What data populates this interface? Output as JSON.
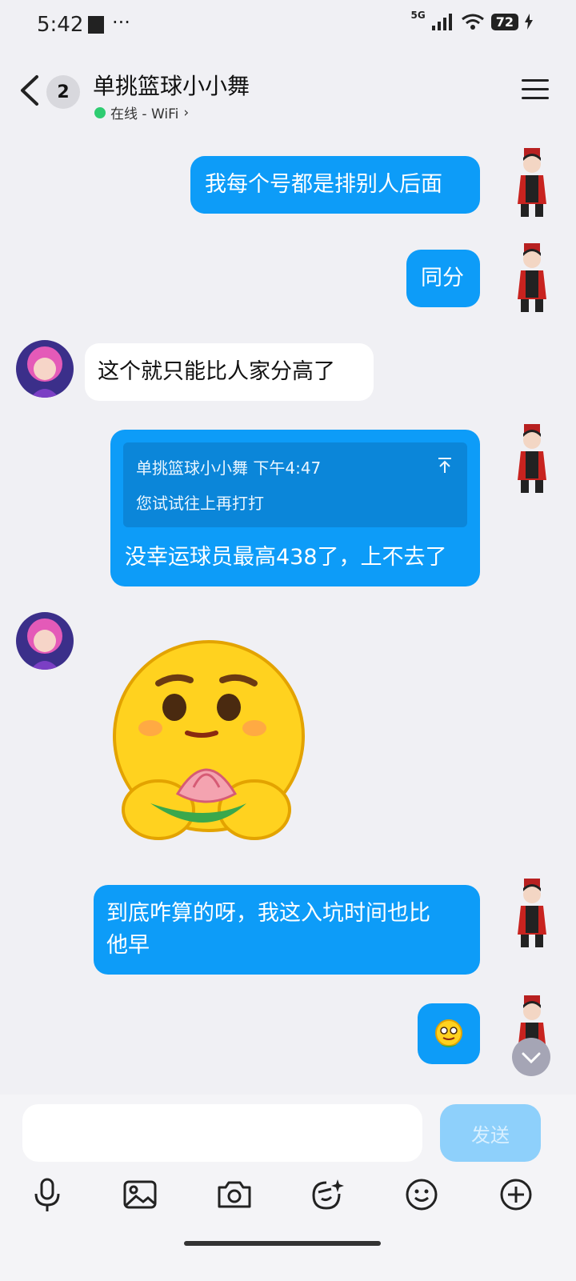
{
  "status_bar": {
    "time": "5:42",
    "dots": "···",
    "network": "5G",
    "battery": "72"
  },
  "header": {
    "unread": "2",
    "title": "单挑篮球小小舞",
    "status": "在线 - WiFi",
    "status_arrow": "›"
  },
  "messages": [
    {
      "side": "out",
      "text": "我每个号都是排别人后面"
    },
    {
      "side": "out",
      "text": "同分"
    },
    {
      "side": "in",
      "text": "这个就只能比人家分高了"
    },
    {
      "side": "out",
      "quote": {
        "name": "单挑篮球小小舞",
        "time": "下午4:47",
        "text": "您试试往上再打打",
        "icon": "up-arrow-icon"
      },
      "text": "没幸运球员最高438了，上不去了"
    },
    {
      "side": "in",
      "sticker": "praying-smiley-sticker"
    },
    {
      "side": "out",
      "text_line1": "到底咋算的呀，我这入坑时间也比",
      "text_line2": "他早"
    },
    {
      "side": "out",
      "sticker": "small-emoji"
    }
  ],
  "composer": {
    "send_label": "发送",
    "tools": [
      "microphone-icon",
      "image-icon",
      "camera-icon",
      "sticker-icon",
      "emoji-icon",
      "plus-icon"
    ]
  },
  "colors": {
    "bubble_out": "#0d9cf8",
    "bubble_in": "#ffffff",
    "background": "#f0f0f4",
    "online": "#2ecc71"
  }
}
